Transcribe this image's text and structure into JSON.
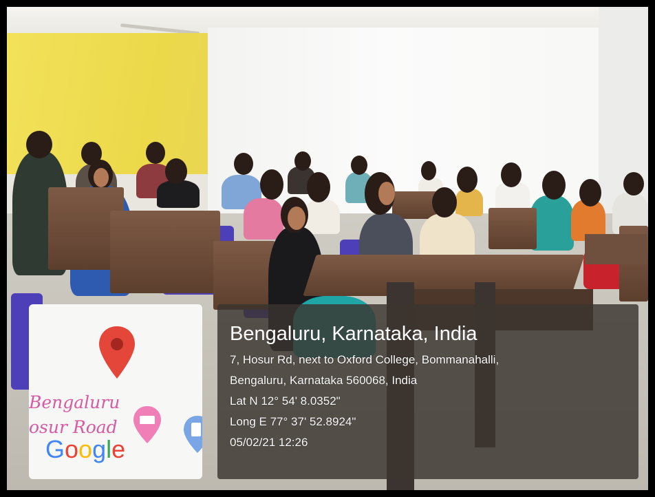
{
  "geotag": {
    "map": {
      "place_line1": "Bengaluru",
      "place_line2": "osur Road",
      "logo": "Google",
      "icons": [
        "map-pin-icon",
        "hotel-bed-icon",
        "fuel-station-icon"
      ]
    },
    "title": "Bengaluru, Karnataka, India",
    "address_line1": "7, Hosur Rd, next to Oxford College, Bommanahalli,",
    "address_line2": "Bengaluru, Karnataka 560068, India",
    "latitude": "Lat N 12° 54' 8.0352\"",
    "longitude": "Long E 77° 37' 52.8924\"",
    "timestamp": "05/02/21 12:26"
  },
  "colors": {
    "pin": "#e5463a",
    "map_label": "#d85aa3",
    "panel_bg": "#3a3430"
  }
}
